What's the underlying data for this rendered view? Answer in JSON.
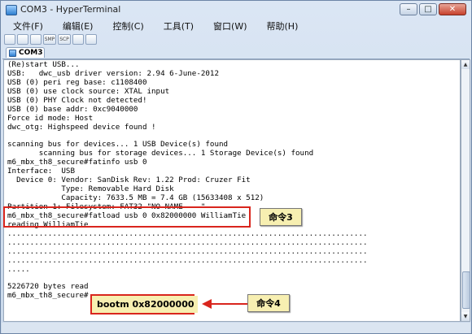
{
  "window": {
    "title": "COM3 - HyperTerminal",
    "min": "–",
    "max": "□",
    "close": "✕"
  },
  "menu": [
    "文件(F)",
    "编辑(E)",
    "控制(C)",
    "工具(T)",
    "窗口(W)",
    "帮助(H)"
  ],
  "toolbar": [
    "new",
    "open",
    "save",
    "SMP",
    "SCP",
    "refresh",
    "properties"
  ],
  "tab": {
    "label": "COM3"
  },
  "terminal": {
    "lines": [
      "(Re)start USB...",
      "USB:   dwc_usb driver version: 2.94 6-June-2012",
      "USB (0) peri reg base: c1108400",
      "USB (0) use clock source: XTAL input",
      "USB (0) PHY Clock not detected!",
      "USB (0) base addr: 0xc9040000",
      "Force id mode: Host",
      "dwc_otg: Highspeed device found !",
      "",
      "scanning bus for devices... 1 USB Device(s) found",
      "       scanning bus for storage devices... 1 Storage Device(s) found",
      "m6_mbx_th8_secure#fatinfo usb 0",
      "Interface:  USB",
      "  Device 0: Vendor: SanDisk Rev: 1.22 Prod: Cruzer Fit",
      "            Type: Removable Hard Disk",
      "            Capacity: 7633.5 MB = 7.4 GB (15633408 x 512)",
      "Partition 1: Filesystem: FAT32 \"NO NAME    \"",
      "m6_mbx_th8_secure#fatload usb 0 0x82000000 WilliamTie",
      "reading WilliamTie",
      "................................................................................",
      "................................................................................",
      "................................................................................",
      "................................................................................",
      ".....",
      "",
      "5226720 bytes read",
      "m6_mbx_th8_secure#"
    ]
  },
  "annotations": {
    "cmd3_label": "命令3",
    "cmd4_label": "命令4",
    "bootm_text": "bootm 0x82000000"
  },
  "colors": {
    "highlight_border": "#d9251d",
    "callout_bg": "#f7efb1"
  }
}
